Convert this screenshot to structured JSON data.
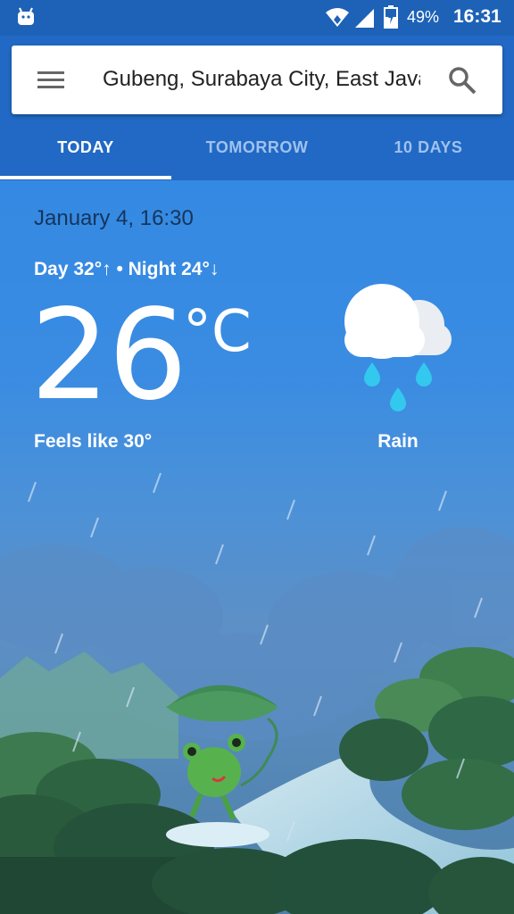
{
  "status_bar": {
    "battery": "49%",
    "time": "16:31"
  },
  "search": {
    "location": "Gubeng, Surabaya City, East Java"
  },
  "tabs": [
    {
      "label": "TODAY",
      "active": true
    },
    {
      "label": "TOMORROW",
      "active": false
    },
    {
      "label": "10 DAYS",
      "active": false
    }
  ],
  "weather": {
    "date_time": "January 4, 16:30",
    "day_night": "Day 32°↑ • Night 24°↓",
    "temperature": "26",
    "unit": "°C",
    "feels_like": "Feels like 30°",
    "condition": "Rain",
    "condition_icon": "rain-cloud-icon"
  },
  "colors": {
    "header": "#2169c4",
    "status_bar": "#1d62b6",
    "rain_drop": "#33c9ee"
  }
}
